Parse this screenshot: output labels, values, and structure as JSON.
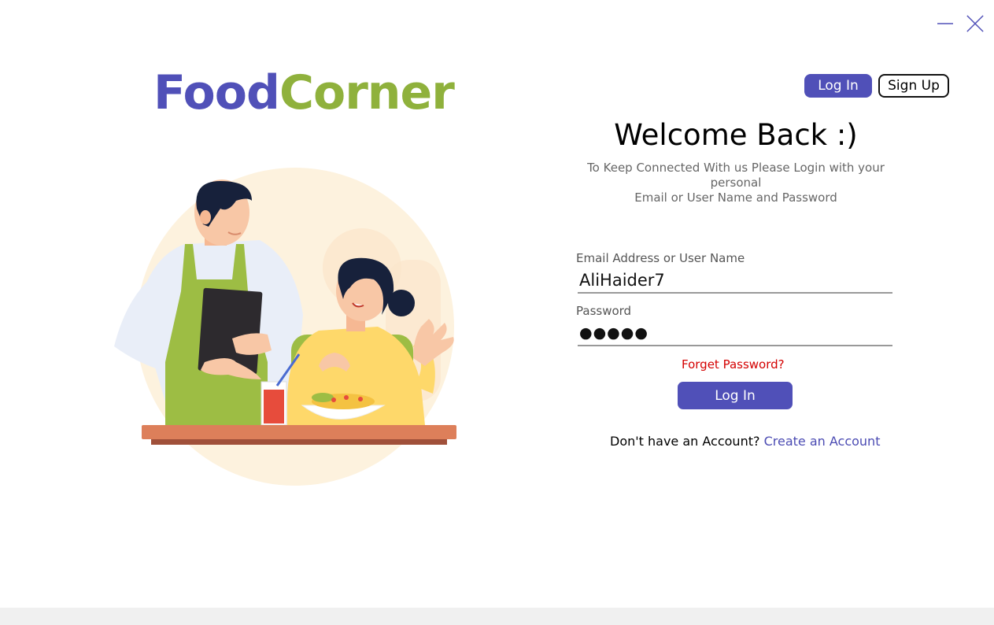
{
  "window": {
    "minimize_icon": "minimize-icon",
    "close_icon": "close-icon"
  },
  "brand": {
    "part1": "Food",
    "part2": "Corner",
    "colors": {
      "food": "#5050b8",
      "corner": "#8fb13c"
    }
  },
  "top_nav": {
    "login_label": "Log In",
    "signup_label": "Sign Up"
  },
  "welcome": {
    "title": "Welcome Back :)",
    "subtitle_line1": "To Keep Connected With us Please Login with your personal",
    "subtitle_line2": "Email or User Name and Password"
  },
  "form": {
    "email_label": "Email Address or User Name",
    "email_value": "AliHaider7",
    "password_label": "Password",
    "password_value": "●●●●●",
    "forget_label": "Forget Password?",
    "submit_label": "Log In"
  },
  "account": {
    "prompt": "Don't have an Account?",
    "link": "Create an Account"
  },
  "accent_color": "#5050b8",
  "error_color": "#d40000"
}
